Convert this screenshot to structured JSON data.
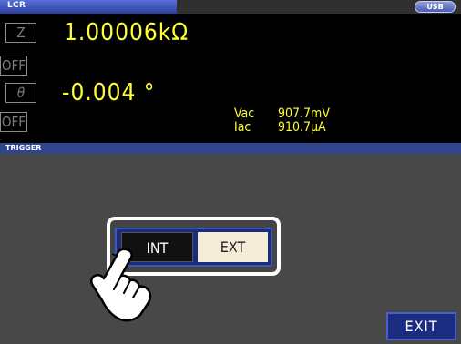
{
  "header": {
    "title": "LCR",
    "usb": "USB"
  },
  "measurement": {
    "param1_label": "Z",
    "param1_value": "1.00006kΩ",
    "off1": "OFF",
    "param2_label": "θ",
    "param2_value": "-0.004 °",
    "off2": "OFF",
    "monitor": [
      {
        "label": "Vac",
        "value": "907.7mV"
      },
      {
        "label": "Iac",
        "value": "910.7μA"
      }
    ]
  },
  "trigger": {
    "section_title": "TRIGGER",
    "options": {
      "int": "INT",
      "ext": "EXT"
    },
    "selected": "INT"
  },
  "exit_label": "EXIT",
  "colors": {
    "value_text": "#ffff33",
    "title_tab": "#3a52b8",
    "button_blue": "#1c2c80",
    "panel_bg": "#484848"
  },
  "icons": [
    "pointing-hand-icon"
  ]
}
